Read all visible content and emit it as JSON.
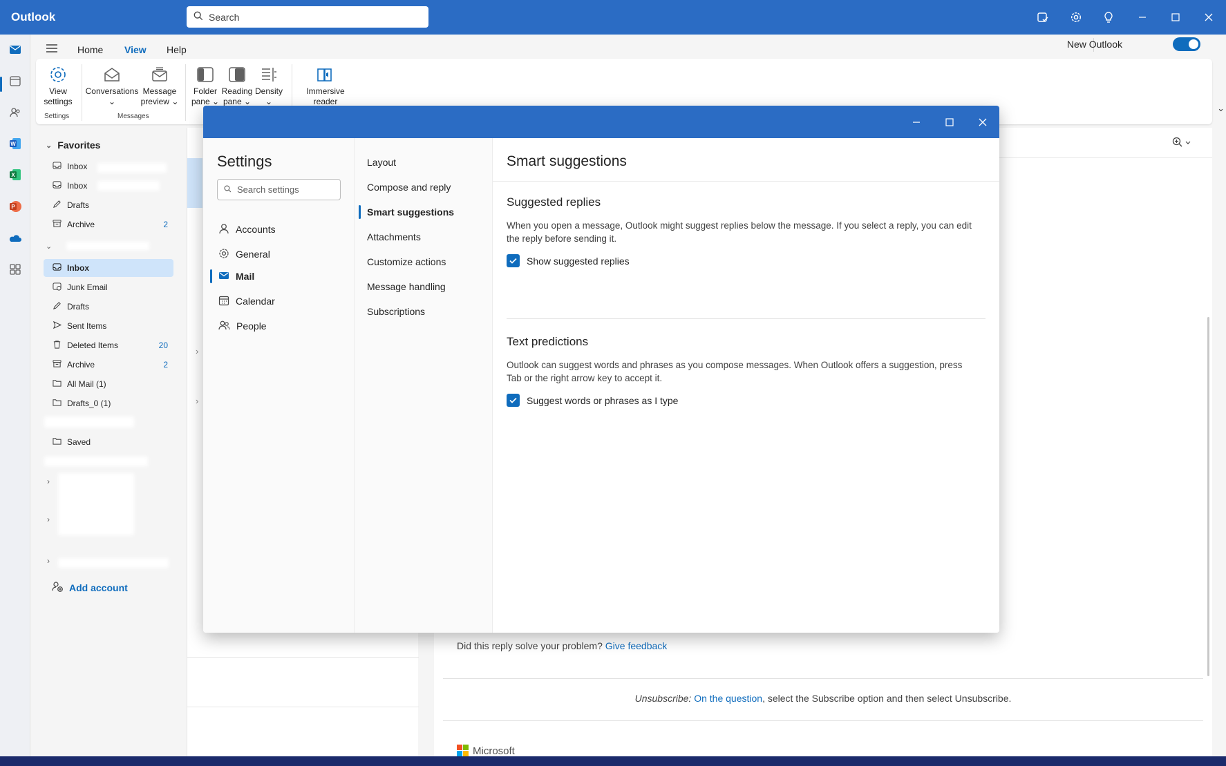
{
  "app": {
    "title": "Outlook"
  },
  "search": {
    "placeholder": "Search"
  },
  "ribbon": {
    "tabs": [
      "Home",
      "View",
      "Help"
    ],
    "active_tab": "View",
    "new_outlook_label": "New Outlook",
    "new_outlook_on": true,
    "buttons": {
      "view_settings": [
        "View",
        "settings"
      ],
      "conversations": "Conversations",
      "message_preview": [
        "Message",
        "preview"
      ],
      "folder_pane": [
        "Folder",
        "pane"
      ],
      "reading_pane": [
        "Reading",
        "pane"
      ],
      "density": "Density",
      "immersive_reader": [
        "Immersive",
        "reader"
      ]
    },
    "groups": {
      "settings": "Settings",
      "messages": "Messages"
    }
  },
  "folders": {
    "favorites_label": "Favorites",
    "favorites": [
      {
        "label": "Inbox",
        "icon": "inbox-icon",
        "count": ""
      },
      {
        "label": "Inbox",
        "icon": "inbox-icon",
        "count": ""
      },
      {
        "label": "Drafts",
        "icon": "drafts-icon",
        "count": ""
      },
      {
        "label": "Archive",
        "icon": "archive-icon",
        "count": "2"
      }
    ],
    "account_folders": [
      {
        "label": "Inbox",
        "icon": "inbox-icon",
        "count": "",
        "selected": true
      },
      {
        "label": "Junk Email",
        "icon": "junk-icon",
        "count": ""
      },
      {
        "label": "Drafts",
        "icon": "drafts-icon",
        "count": ""
      },
      {
        "label": "Sent Items",
        "icon": "sent-icon",
        "count": ""
      },
      {
        "label": "Deleted Items",
        "icon": "trash-icon",
        "count": "20"
      },
      {
        "label": "Archive",
        "icon": "archive-icon",
        "count": "2"
      },
      {
        "label": "All Mail (1)",
        "icon": "folder-icon",
        "count": ""
      },
      {
        "label": "Drafts_0 (1)",
        "icon": "folder-icon",
        "count": ""
      },
      {
        "label": "Saved",
        "icon": "folder-icon",
        "count": ""
      }
    ],
    "add_account": "Add account"
  },
  "reading": {
    "feedback_prefix": "Did this reply solve your problem?",
    "feedback_link": "Give feedback",
    "unsub_prefix": "Unsubscribe:",
    "unsub_link": "On the question",
    "unsub_suffix": ", select the Subscribe option and then select Unsubscribe.",
    "brand": "Microsoft"
  },
  "settings": {
    "title": "Settings",
    "search_placeholder": "Search settings",
    "categories": [
      {
        "label": "Accounts",
        "icon": "person-icon"
      },
      {
        "label": "General",
        "icon": "gear-icon"
      },
      {
        "label": "Mail",
        "icon": "mail-icon",
        "active": true
      },
      {
        "label": "Calendar",
        "icon": "calendar-icon"
      },
      {
        "label": "People",
        "icon": "people-icon"
      }
    ],
    "subcategories": [
      "Layout",
      "Compose and reply",
      "Smart suggestions",
      "Attachments",
      "Customize actions",
      "Message handling",
      "Subscriptions"
    ],
    "active_subcategory": "Smart suggestions",
    "pane_title": "Smart suggestions",
    "sections": [
      {
        "title": "Suggested replies",
        "description": "When you open a message, Outlook might suggest replies below the message. If you select a reply, you can edit the reply before sending it.",
        "checkbox_label": "Show suggested replies",
        "checked": true
      },
      {
        "title": "Text predictions",
        "description": "Outlook can suggest words and phrases as you compose messages. When Outlook offers a suggestion, press Tab or the right arrow key to accept it.",
        "checkbox_label": "Suggest words or phrases as I type",
        "checked": true
      }
    ]
  },
  "colors": {
    "brand": "#2b6cc4",
    "accent": "#0f6cbd",
    "selected": "#cfe4fa"
  }
}
